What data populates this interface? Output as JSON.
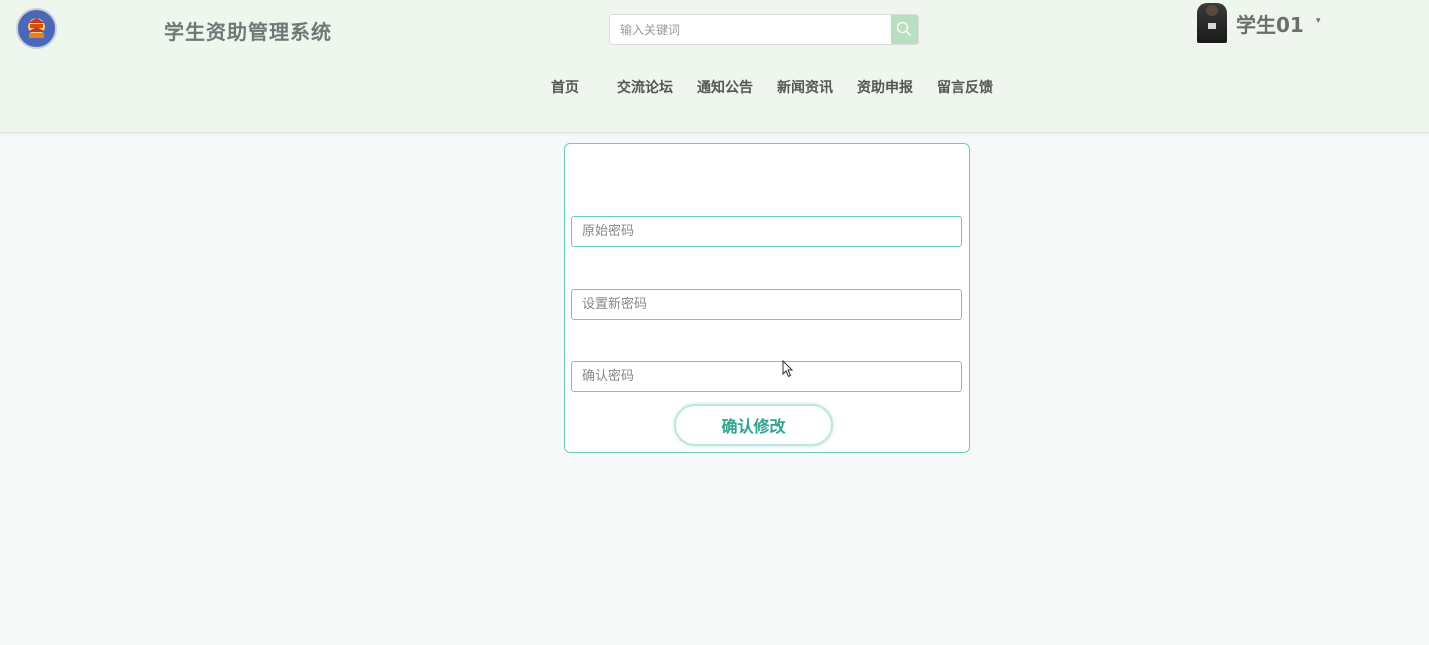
{
  "header": {
    "site_title": "学生资助管理系统",
    "search": {
      "placeholder": "输入关键词",
      "icon": "search-icon"
    },
    "user": {
      "name": "学生01",
      "caret": "▾"
    }
  },
  "nav": {
    "items": [
      {
        "label": "首页"
      },
      {
        "label": "交流论坛"
      },
      {
        "label": "通知公告"
      },
      {
        "label": "新闻资讯"
      },
      {
        "label": "资助申报"
      },
      {
        "label": "留言反馈"
      }
    ]
  },
  "form": {
    "old_password_placeholder": "原始密码",
    "new_password_placeholder": "设置新密码",
    "confirm_password_placeholder": "确认密码",
    "submit_label": "确认修改"
  },
  "colors": {
    "header_bg": "#eff6ed",
    "accent": "#6ec9bf",
    "button_text": "#2fa38f",
    "search_button": "#b9dfc2"
  }
}
